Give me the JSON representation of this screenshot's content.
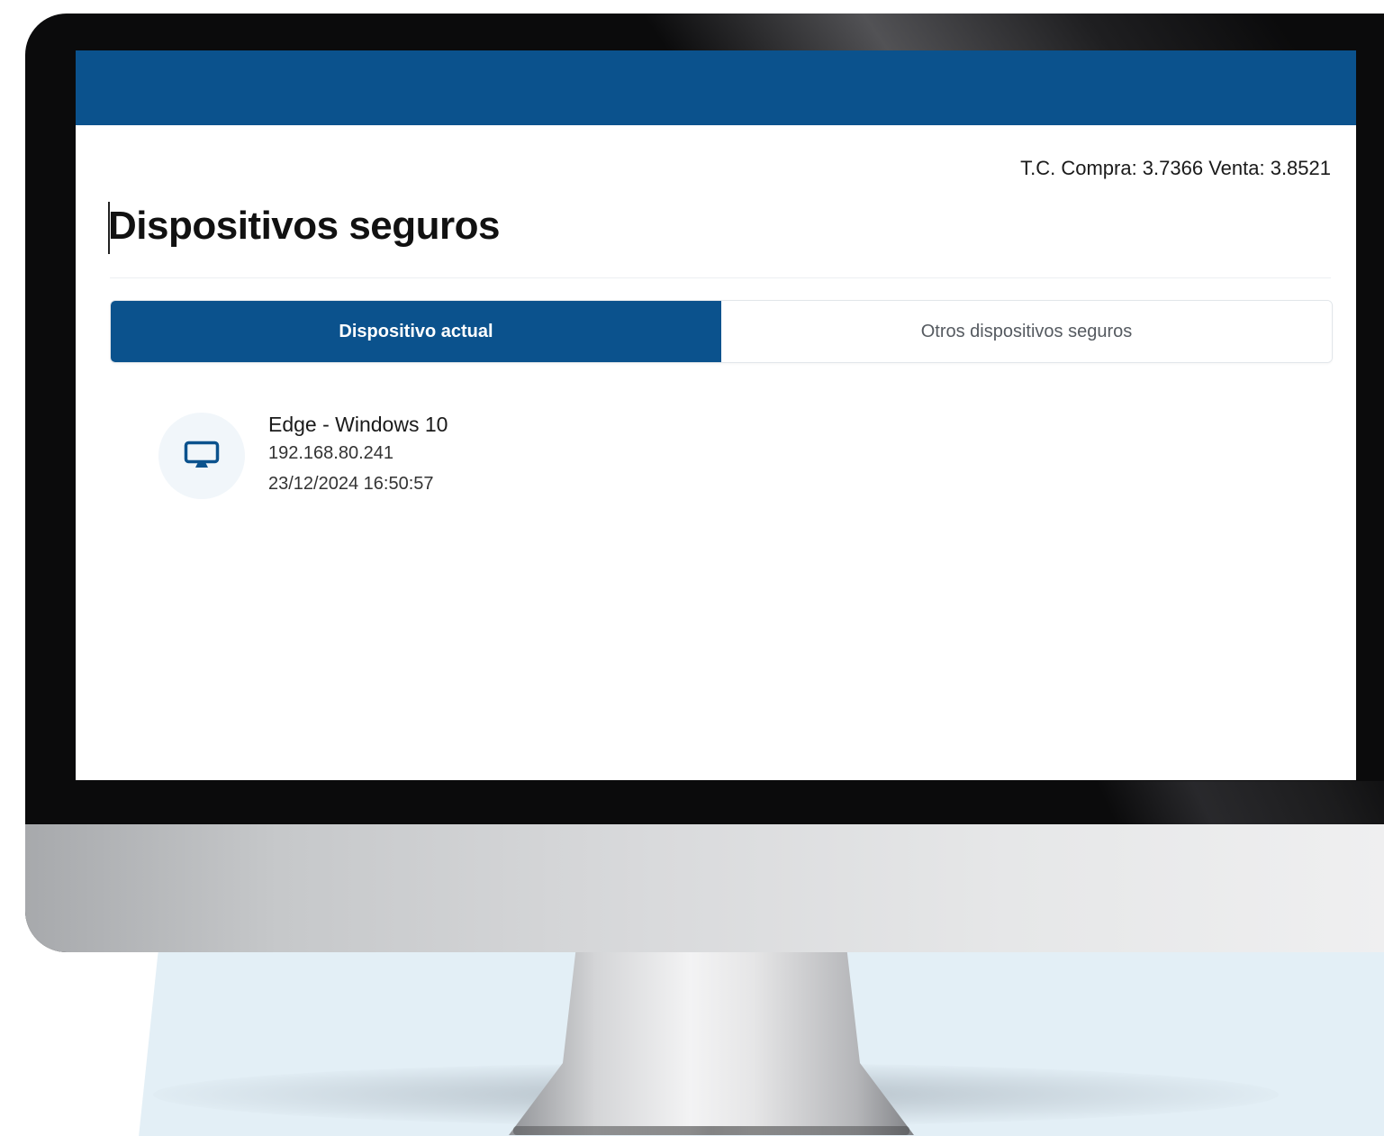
{
  "header": {
    "exchange_rate": "T.C. Compra: 3.7366 Venta: 3.8521"
  },
  "page": {
    "title": "Dispositivos seguros"
  },
  "tabs": [
    {
      "label": "Dispositivo actual",
      "active": true
    },
    {
      "label": "Otros dispositivos seguros",
      "active": false
    }
  ],
  "device": {
    "icon": "monitor-icon",
    "name": "Edge - Windows 10",
    "ip": "192.168.80.241",
    "date": "23/12/2024 16:50:57"
  },
  "colors": {
    "brand_blue": "#0b528d",
    "icon_circle": "#f1f6fa",
    "backdrop": "#e3eff6"
  }
}
